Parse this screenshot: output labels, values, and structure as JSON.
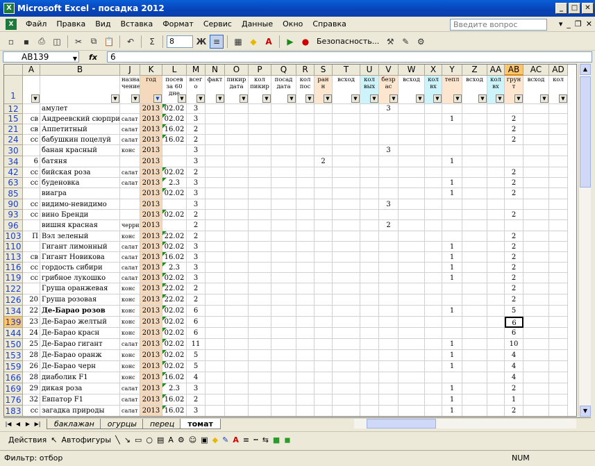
{
  "window": {
    "title": "Microsoft Excel - посадка 2012"
  },
  "menu": [
    "Файл",
    "Правка",
    "Вид",
    "Вставка",
    "Формат",
    "Сервис",
    "Данные",
    "Окно",
    "Справка"
  ],
  "help_placeholder": "Введите вопрос",
  "toolbar": {
    "font_size": "8",
    "bold": "Ж",
    "security": "Безопасность..."
  },
  "formula_bar": {
    "name_box": "AB139",
    "fx": "fx",
    "value": "6"
  },
  "columns": [
    {
      "id": "corner",
      "label": ""
    },
    {
      "id": "A",
      "label": "A"
    },
    {
      "id": "B",
      "label": "B"
    },
    {
      "id": "J",
      "label": "J"
    },
    {
      "id": "K",
      "label": "K"
    },
    {
      "id": "L",
      "label": "L"
    },
    {
      "id": "M",
      "label": "M"
    },
    {
      "id": "N",
      "label": "N"
    },
    {
      "id": "O",
      "label": "O"
    },
    {
      "id": "P",
      "label": "P"
    },
    {
      "id": "Q",
      "label": "Q"
    },
    {
      "id": "R",
      "label": "R"
    },
    {
      "id": "S",
      "label": "S"
    },
    {
      "id": "T",
      "label": "T"
    },
    {
      "id": "U",
      "label": "U"
    },
    {
      "id": "V",
      "label": "V"
    },
    {
      "id": "W",
      "label": "W"
    },
    {
      "id": "X",
      "label": "X"
    },
    {
      "id": "Y",
      "label": "Y"
    },
    {
      "id": "Z",
      "label": "Z"
    },
    {
      "id": "AA",
      "label": "AA"
    },
    {
      "id": "AB",
      "label": "AB"
    },
    {
      "id": "AC",
      "label": "AC"
    },
    {
      "id": "AD",
      "label": "AD"
    }
  ],
  "header_row": {
    "row_number": "1",
    "cells": [
      "",
      "",
      "",
      "назна чение",
      "год",
      "посев за 60 дне",
      "всег о",
      "факт",
      "пикир дата",
      "кол пикир",
      "посад дата",
      "кол пос",
      "ран н",
      "всход",
      "кол вых",
      "безр ас",
      "всход",
      "кол вх",
      "тепл",
      "всход",
      "кол вх",
      "грун т",
      "всход",
      "кол"
    ]
  },
  "rows": [
    {
      "n": "12",
      "a": "",
      "b": "амулет",
      "j": "",
      "k": "2013",
      "l": "02.02",
      "m": "3",
      "v": "3",
      "y": "",
      "ab": ""
    },
    {
      "n": "15",
      "a": "св",
      "b": "Андреевский сюрприз",
      "j": "салат",
      "k": "2013",
      "l": "02.02",
      "m": "3",
      "v": "",
      "y": "1",
      "ab": "2"
    },
    {
      "n": "21",
      "a": "св",
      "b": "Аппетитный",
      "j": "салат",
      "k": "2013",
      "l": "16.02",
      "m": "2",
      "v": "",
      "y": "",
      "ab": "2"
    },
    {
      "n": "24",
      "a": "сс",
      "b": "бабушкин поцелуй",
      "j": "салат",
      "k": "2013",
      "l": "16.02",
      "m": "2",
      "v": "",
      "y": "",
      "ab": "2"
    },
    {
      "n": "30",
      "a": "",
      "b": "банан красный",
      "j": "конс",
      "k": "2013",
      "l": "",
      "m": "3",
      "v": "3",
      "y": "",
      "ab": ""
    },
    {
      "n": "34",
      "a": "6",
      "b": "батяня",
      "j": "",
      "k": "2013",
      "l": "",
      "m": "3",
      "s": "2",
      "v": "",
      "y": "1",
      "ab": ""
    },
    {
      "n": "42",
      "a": "сс",
      "b": "бийская роза",
      "j": "салат",
      "k": "2013",
      "l": "02.02",
      "m": "2",
      "v": "",
      "y": "",
      "ab": "2"
    },
    {
      "n": "63",
      "a": "сс",
      "b": "буденовка",
      "j": "салат",
      "k": "2013",
      "l": "2.3",
      "m": "3",
      "v": "",
      "y": "1",
      "ab": "2"
    },
    {
      "n": "85",
      "a": "",
      "b": "виагра",
      "j": "",
      "k": "2013",
      "l": "02.02",
      "m": "3",
      "v": "",
      "y": "1",
      "ab": "2"
    },
    {
      "n": "90",
      "a": "сс",
      "b": "видимо-невидимо",
      "j": "",
      "k": "2013",
      "l": "",
      "m": "3",
      "v": "3",
      "y": "",
      "ab": ""
    },
    {
      "n": "93",
      "a": "сс",
      "b": "вино Бренди",
      "j": "",
      "k": "2013",
      "l": "02.02",
      "m": "2",
      "v": "",
      "y": "",
      "ab": "2"
    },
    {
      "n": "96",
      "a": "",
      "b": "вишня красная",
      "j": "черри",
      "k": "2013",
      "l": "",
      "m": "2",
      "v": "2",
      "y": "",
      "ab": ""
    },
    {
      "n": "103",
      "a": "П",
      "b": "Вэл зеленый",
      "j": "конс",
      "k": "2013",
      "l": "22.02",
      "m": "2",
      "v": "",
      "y": "",
      "ab": "2"
    },
    {
      "n": "110",
      "a": "",
      "b": "Гигант лимонный",
      "j": "салат",
      "k": "2013",
      "l": "02.02",
      "m": "3",
      "v": "",
      "y": "1",
      "ab": "2"
    },
    {
      "n": "113",
      "a": "св",
      "b": "Гигант Новикова",
      "j": "салат",
      "k": "2013",
      "l": "16.02",
      "m": "3",
      "v": "",
      "y": "1",
      "ab": "2"
    },
    {
      "n": "116",
      "a": "сс",
      "b": "гордость сибири",
      "j": "салат",
      "k": "2013",
      "l": "2.3",
      "m": "3",
      "v": "",
      "y": "1",
      "ab": "2"
    },
    {
      "n": "119",
      "a": "сс",
      "b": "грибное лукошко",
      "j": "салат",
      "k": "2013",
      "l": "02.02",
      "m": "3",
      "v": "",
      "y": "1",
      "ab": "2"
    },
    {
      "n": "122",
      "a": "",
      "b": "Груша оранжевая",
      "j": "конс",
      "k": "2013",
      "l": "22.02",
      "m": "2",
      "v": "",
      "y": "",
      "ab": "2"
    },
    {
      "n": "126",
      "a": "20",
      "b": "Груша розовая",
      "j": "конс",
      "k": "2013",
      "l": "22.02",
      "m": "2",
      "v": "",
      "y": "",
      "ab": "2"
    },
    {
      "n": "134",
      "a": "22",
      "b": "Де-Барао розов",
      "j": "конс",
      "k": "2013",
      "l": "02.02",
      "m": "6",
      "v": "",
      "y": "1",
      "ab": "5",
      "bold": true
    },
    {
      "n": "139",
      "a": "23",
      "b": "Де-Барао желтый",
      "j": "конс",
      "k": "2013",
      "l": "02.02",
      "m": "6",
      "v": "",
      "y": "",
      "ab": "6",
      "sel": true
    },
    {
      "n": "144",
      "a": "24",
      "b": "Де-Барао красн",
      "j": "конс",
      "k": "2013",
      "l": "02.02",
      "m": "6",
      "v": "",
      "y": "",
      "ab": "6"
    },
    {
      "n": "150",
      "a": "25",
      "b": "Де-Барао гигант",
      "j": "салат",
      "k": "2013",
      "l": "02.02",
      "m": "11",
      "v": "",
      "y": "1",
      "ab": "10"
    },
    {
      "n": "153",
      "a": "28",
      "b": "Де-Барао оранж",
      "j": "конс",
      "k": "2013",
      "l": "02.02",
      "m": "5",
      "v": "",
      "y": "1",
      "ab": "4"
    },
    {
      "n": "159",
      "a": "26",
      "b": "Де-Барао черн",
      "j": "конс",
      "k": "2013",
      "l": "02.02",
      "m": "5",
      "v": "",
      "y": "1",
      "ab": "4"
    },
    {
      "n": "166",
      "a": "28",
      "b": "диаболик F1",
      "j": "конс",
      "k": "2013",
      "l": "16.02",
      "m": "4",
      "v": "",
      "y": "",
      "ab": "4"
    },
    {
      "n": "169",
      "a": "29",
      "b": "дикая роза",
      "j": "салат",
      "k": "2013",
      "l": "2.3",
      "m": "3",
      "v": "",
      "y": "1",
      "ab": "2"
    },
    {
      "n": "176",
      "a": "32",
      "b": "Евпатор F1",
      "j": "салат",
      "k": "2013",
      "l": "16.02",
      "m": "2",
      "v": "",
      "y": "1",
      "ab": "1"
    },
    {
      "n": "183",
      "a": "сс",
      "b": "загадка природы",
      "j": "салат",
      "k": "2013",
      "l": "16.02",
      "m": "3",
      "v": "",
      "y": "1",
      "ab": "2"
    }
  ],
  "sheets": [
    "баклажан",
    "огурцы",
    "перец",
    "томат"
  ],
  "active_sheet": "томат",
  "drawbar": {
    "actions": "Действия",
    "autoshapes": "Автофигуры"
  },
  "status": {
    "left": "Фильтр: отбор",
    "num": "NUM"
  },
  "colors": {
    "title": "#0a4fc8",
    "selected_header": "#ffc56b",
    "year_fill": "#f5d9bc",
    "cyan_header": "#cef4fb"
  }
}
